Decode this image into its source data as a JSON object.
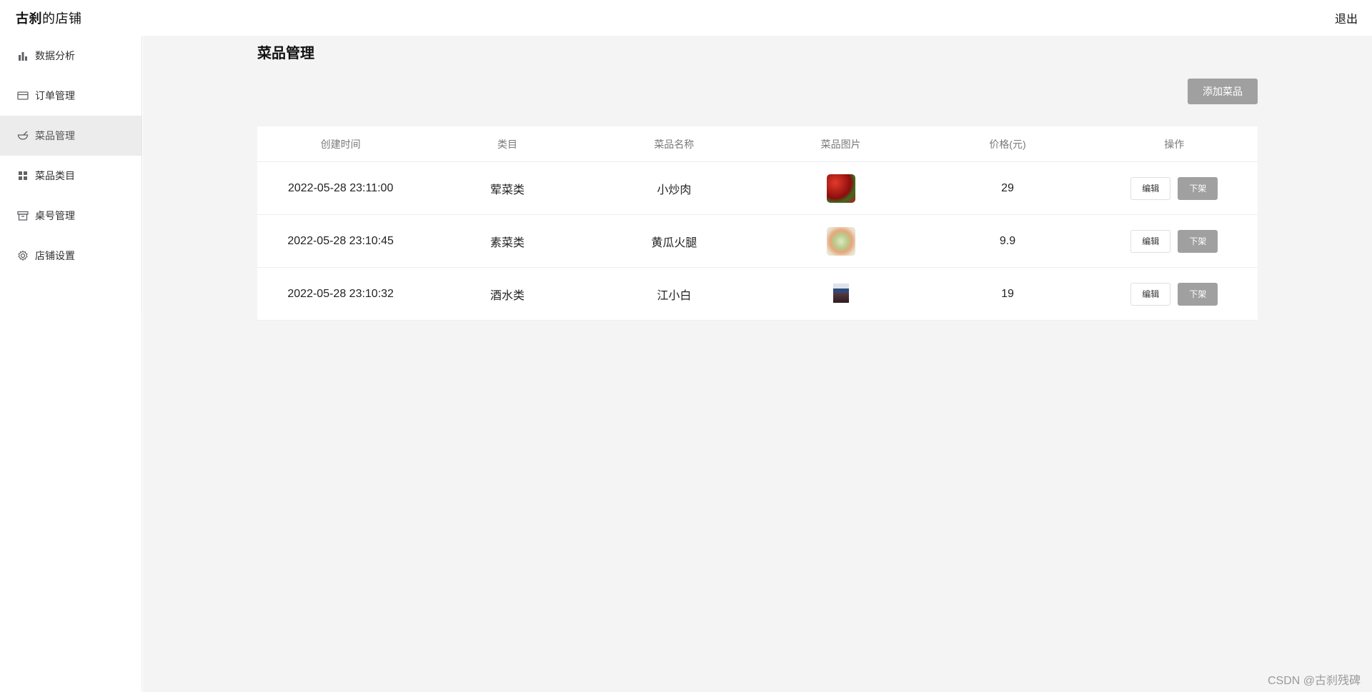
{
  "header": {
    "title_bold": "古刹",
    "title_rest": "的店铺",
    "logout_label": "退出"
  },
  "sidebar": {
    "items": [
      {
        "label": "数据分析",
        "icon": "bar-chart-icon",
        "active": false
      },
      {
        "label": "订单管理",
        "icon": "credit-card-icon",
        "active": false
      },
      {
        "label": "菜品管理",
        "icon": "bowl-icon",
        "active": true
      },
      {
        "label": "菜品类目",
        "icon": "grid-icon",
        "active": false
      },
      {
        "label": "桌号管理",
        "icon": "box-icon",
        "active": false
      },
      {
        "label": "店铺设置",
        "icon": "gear-icon",
        "active": false
      }
    ]
  },
  "main": {
    "title": "菜品管理",
    "add_button_label": "添加菜品",
    "table": {
      "columns": [
        "创建时间",
        "类目",
        "菜品名称",
        "菜品图片",
        "价格(元)",
        "操作"
      ],
      "rows": [
        {
          "created": "2022-05-28 23:11:00",
          "category": "荤菜类",
          "name": "小炒肉",
          "image": "stir-fried-pork-thumbnail",
          "price": "29"
        },
        {
          "created": "2022-05-28 23:10:45",
          "category": "素菜类",
          "name": "黄瓜火腿",
          "image": "cucumber-ham-thumbnail",
          "price": "9.9"
        },
        {
          "created": "2022-05-28 23:10:32",
          "category": "酒水类",
          "name": "江小白",
          "image": "liquor-bottle-thumbnail",
          "price": "19"
        }
      ],
      "edit_label": "编辑",
      "off_shelf_label": "下架"
    }
  },
  "watermark": "CSDN @古刹残碑",
  "colors": {
    "main_bg": "#f4f4f5",
    "active_nav_bg": "#ececec",
    "button_gray": "#a0a0a0"
  }
}
